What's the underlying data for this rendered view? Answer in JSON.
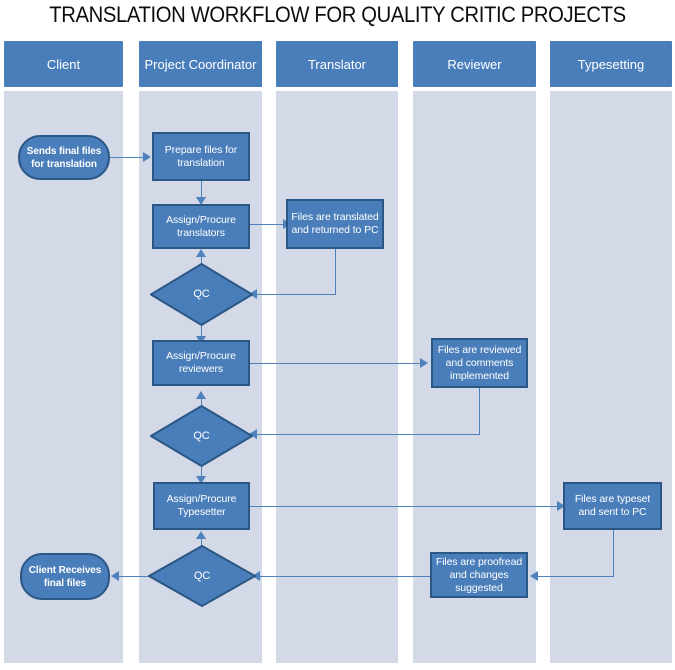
{
  "title": "TRANSLATION WORKFLOW FOR QUALITY CRITIC PROJECTS",
  "colors": {
    "node_fill": "#4A7EBB",
    "node_border": "#2B5785",
    "lane_header_fill": "#4A7EBB",
    "lane_body_fill": "#D4D9E8",
    "connector": "#4F81BD",
    "title_text": "#0D0D0D",
    "node_text": "#FFFFFF",
    "page_background": "#FFFFFF"
  },
  "lanes": [
    {
      "id": "client",
      "label": "Client"
    },
    {
      "id": "project-coordinator",
      "label": "Project Coordinator"
    },
    {
      "id": "translator",
      "label": "Translator"
    },
    {
      "id": "reviewer",
      "label": "Reviewer"
    },
    {
      "id": "typesetting",
      "label": "Typesetting"
    }
  ],
  "nodes": {
    "client_send": {
      "label": "Sends final files for translation",
      "shape": "terminator",
      "lane": "client"
    },
    "client_receive": {
      "label": "Client Receives final files",
      "shape": "terminator",
      "lane": "client"
    },
    "prepare_files": {
      "label": "Prepare files for translation",
      "shape": "process",
      "lane": "project-coordinator"
    },
    "assign_translators": {
      "label": "Assign/Procure translators",
      "shape": "process",
      "lane": "project-coordinator"
    },
    "qc_1": {
      "label": "QC",
      "shape": "decision",
      "lane": "project-coordinator"
    },
    "assign_reviewers": {
      "label": "Assign/Procure reviewers",
      "shape": "process",
      "lane": "project-coordinator"
    },
    "qc_2": {
      "label": "QC",
      "shape": "decision",
      "lane": "project-coordinator"
    },
    "assign_typesetter": {
      "label": "Assign/Procure Typesetter",
      "shape": "process",
      "lane": "project-coordinator"
    },
    "qc_3": {
      "label": "QC",
      "shape": "decision",
      "lane": "project-coordinator"
    },
    "files_translated": {
      "label": "Files are translated and returned to PC",
      "shape": "process",
      "lane": "translator"
    },
    "files_reviewed": {
      "label": "Files are reviewed and comments implemented",
      "shape": "process",
      "lane": "reviewer"
    },
    "files_proofread": {
      "label": "Files are proofread and changes suggested",
      "shape": "process",
      "lane": "reviewer"
    },
    "files_typeset": {
      "label": "Files are  typeset and sent to PC",
      "shape": "process",
      "lane": "typesetting"
    }
  },
  "flow_edges": [
    {
      "from": "client_send",
      "to": "prepare_files",
      "direction": "right"
    },
    {
      "from": "prepare_files",
      "to": "assign_translators",
      "direction": "down"
    },
    {
      "from": "assign_translators",
      "to": "files_translated",
      "direction": "right"
    },
    {
      "from": "files_translated",
      "to": "qc_1",
      "direction": "left"
    },
    {
      "from": "qc_1",
      "to": "assign_translators",
      "direction": "up"
    },
    {
      "from": "qc_1",
      "to": "assign_reviewers",
      "direction": "down"
    },
    {
      "from": "assign_reviewers",
      "to": "files_reviewed",
      "direction": "right"
    },
    {
      "from": "files_reviewed",
      "to": "qc_2",
      "direction": "left"
    },
    {
      "from": "qc_2",
      "to": "assign_reviewers",
      "direction": "up"
    },
    {
      "from": "qc_2",
      "to": "assign_typesetter",
      "direction": "down"
    },
    {
      "from": "assign_typesetter",
      "to": "files_typeset",
      "direction": "right"
    },
    {
      "from": "files_typeset",
      "to": "files_proofread",
      "direction": "left"
    },
    {
      "from": "files_proofread",
      "to": "qc_3",
      "direction": "left"
    },
    {
      "from": "qc_3",
      "to": "assign_typesetter",
      "direction": "up"
    },
    {
      "from": "qc_3",
      "to": "client_receive",
      "direction": "left"
    }
  ]
}
